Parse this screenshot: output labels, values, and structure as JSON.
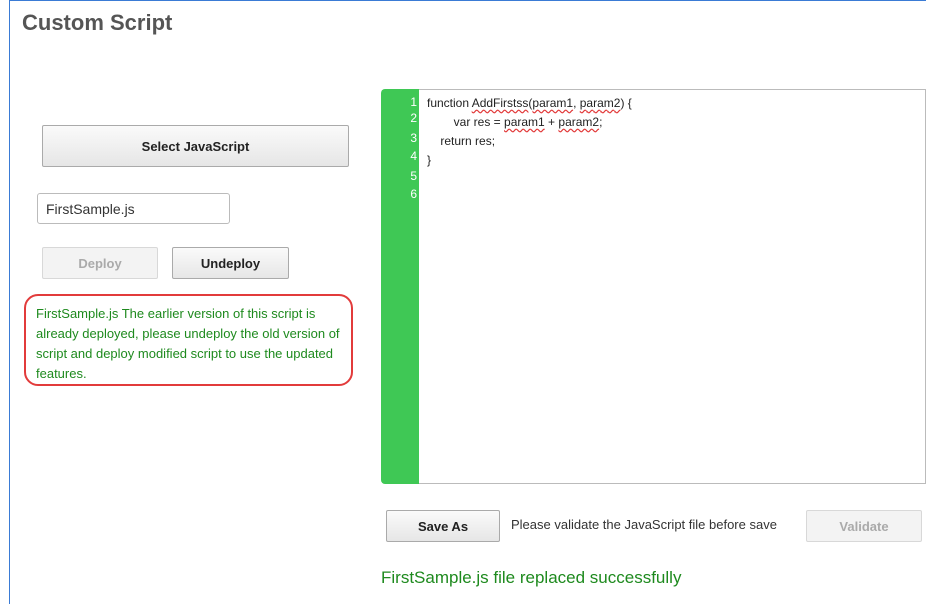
{
  "page": {
    "title": "Custom Script"
  },
  "left": {
    "select_button": "Select JavaScript",
    "file_name": "FirstSample.js",
    "deploy_button": "Deploy",
    "undeploy_button": "Undeploy",
    "warning": "FirstSample.js The earlier version of this script is already deployed, please undeploy the old version of script and deploy modified script to use the updated features."
  },
  "editor": {
    "line_numbers": [
      "1",
      "2",
      "3",
      "4",
      "5",
      "6"
    ],
    "lines": [
      {
        "parts": [
          "function ",
          "AddFirstss",
          "(",
          "param1",
          ", ",
          "param2",
          ") {"
        ]
      },
      {
        "parts": [
          "        var res = ",
          "param1",
          " + ",
          "param2",
          ";"
        ]
      },
      {
        "parts": [
          "    return res;"
        ]
      },
      {
        "parts": [
          "}"
        ]
      },
      {
        "parts": [
          ""
        ]
      },
      {
        "parts": [
          ""
        ]
      }
    ]
  },
  "bottom": {
    "save_as_button": "Save As",
    "validate_message": "Please validate the JavaScript file before save",
    "validate_button": "Validate",
    "success_message": "FirstSample.js file replaced successfully"
  },
  "colors": {
    "gutter": "#3fc855",
    "success_text": "#1e8a1e",
    "warning_border": "#e23b3b"
  }
}
